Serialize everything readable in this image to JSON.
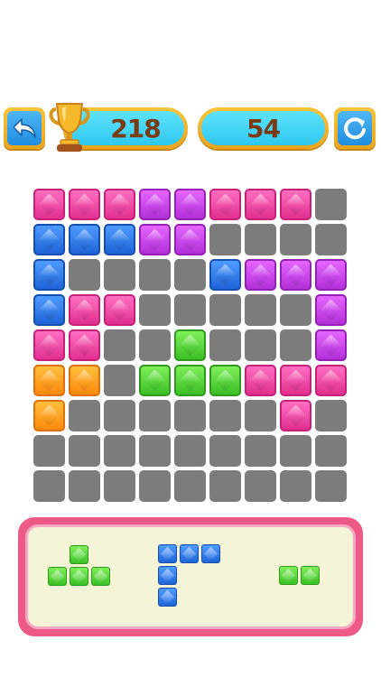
{
  "header": {
    "best_score": "218",
    "current_score": "54",
    "back_icon": "back-arrow-icon",
    "restart_icon": "restart-icon",
    "trophy_icon": "trophy-icon"
  },
  "colors": {
    "pink": "#e0308f",
    "purple": "#b22fd8",
    "blue": "#1e63d6",
    "green": "#3cbf26",
    "orange": "#ff8a0d",
    "empty": "#7c7c7c"
  },
  "board": {
    "size": 9,
    "rows": [
      [
        "pink",
        "pink",
        "pink",
        "purple",
        "purple",
        "pink",
        "pink",
        "pink",
        "empty"
      ],
      [
        "blue",
        "blue",
        "blue",
        "purple",
        "purple",
        "empty",
        "empty",
        "empty",
        "empty"
      ],
      [
        "blue",
        "empty",
        "empty",
        "empty",
        "empty",
        "blue",
        "purple",
        "purple",
        "purple"
      ],
      [
        "blue",
        "pink",
        "pink",
        "empty",
        "empty",
        "empty",
        "empty",
        "empty",
        "purple"
      ],
      [
        "pink",
        "pink",
        "empty",
        "empty",
        "green",
        "empty",
        "empty",
        "empty",
        "purple"
      ],
      [
        "orange",
        "orange",
        "empty",
        "green",
        "green",
        "green",
        "pink",
        "pink",
        "pink"
      ],
      [
        "orange",
        "empty",
        "empty",
        "empty",
        "empty",
        "empty",
        "empty",
        "pink",
        "empty"
      ],
      [
        "empty",
        "empty",
        "empty",
        "empty",
        "empty",
        "empty",
        "empty",
        "empty",
        "empty"
      ],
      [
        "empty",
        "empty",
        "empty",
        "empty",
        "empty",
        "empty",
        "empty",
        "empty",
        "empty"
      ]
    ]
  },
  "tray": {
    "pieces": [
      {
        "name": "t-piece",
        "color": "green",
        "cells": [
          [
            0,
            1
          ],
          [
            1,
            0
          ],
          [
            1,
            1
          ],
          [
            1,
            2
          ]
        ]
      },
      {
        "name": "corner-piece",
        "color": "blue",
        "cells": [
          [
            0,
            0
          ],
          [
            0,
            1
          ],
          [
            0,
            2
          ],
          [
            1,
            0
          ],
          [
            2,
            0
          ]
        ]
      },
      {
        "name": "domino-piece",
        "color": "green",
        "cells": [
          [
            0,
            0
          ],
          [
            0,
            1
          ]
        ]
      }
    ]
  }
}
